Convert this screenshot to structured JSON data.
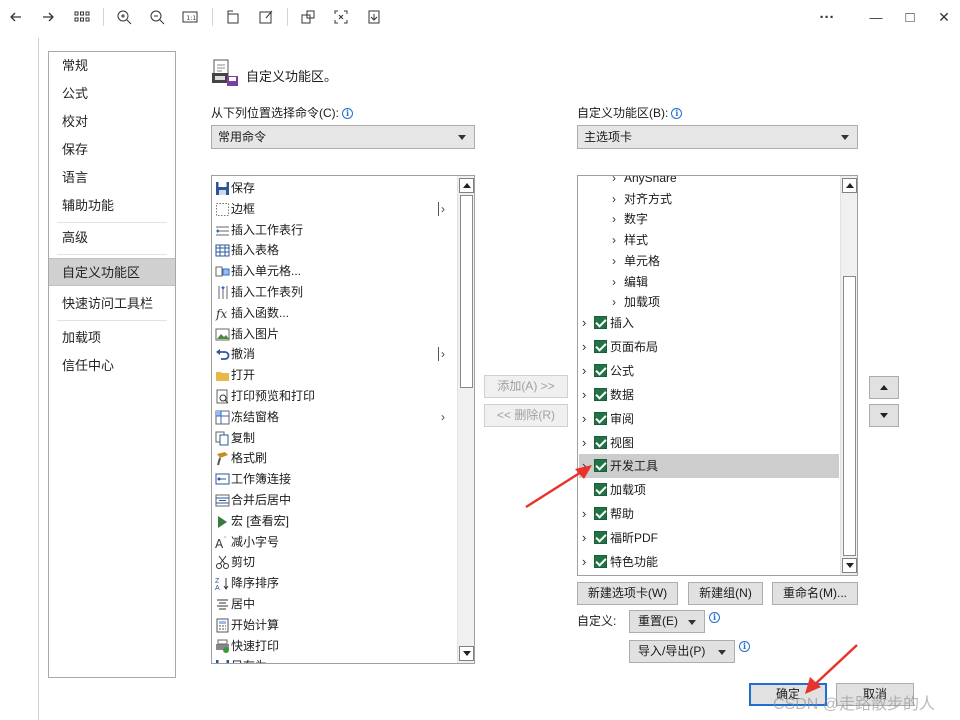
{
  "toolbar": {
    "items": [
      "back-icon",
      "forward-icon",
      "grid-icon",
      "zoom-in-icon",
      "zoom-out-icon",
      "actual-size-icon",
      "rotate-icon",
      "edit-icon",
      "crop-icon",
      "fit-icon",
      "download-icon"
    ],
    "more": "···",
    "minimize": "—",
    "maximize": "□",
    "close": "✕"
  },
  "sidebar": {
    "items": [
      {
        "label": "常规"
      },
      {
        "label": "公式"
      },
      {
        "label": "校对"
      },
      {
        "label": "保存"
      },
      {
        "label": "语言"
      },
      {
        "label": "辅助功能"
      },
      {
        "label": "高级"
      },
      {
        "label": "自定义功能区",
        "selected": true
      },
      {
        "label": "快速访问工具栏"
      },
      {
        "label": "加载项"
      },
      {
        "label": "信任中心"
      }
    ]
  },
  "main": {
    "heading": "自定义功能区。",
    "left_label": "从下列位置选择命令(C):",
    "left_combo": "常用命令",
    "right_label": "自定义功能区(B):",
    "right_combo": "主选项卡",
    "commands": [
      {
        "label": "保存",
        "icon": "save-icon"
      },
      {
        "label": "边框",
        "icon": "border-icon",
        "submenu": "bar"
      },
      {
        "label": "插入工作表行",
        "icon": "insert-row-icon"
      },
      {
        "label": "插入表格",
        "icon": "table-icon"
      },
      {
        "label": "插入单元格...",
        "icon": "insert-cells-icon"
      },
      {
        "label": "插入工作表列",
        "icon": "insert-column-icon"
      },
      {
        "label": "插入函数...",
        "icon": "function-icon"
      },
      {
        "label": "插入图片",
        "icon": "picture-icon"
      },
      {
        "label": "撤消",
        "icon": "undo-icon",
        "submenu": "bar"
      },
      {
        "label": "打开",
        "icon": "folder-icon"
      },
      {
        "label": "打印预览和打印",
        "icon": "print-preview-icon"
      },
      {
        "label": "冻结窗格",
        "icon": "freeze-panes-icon",
        "submenu": "arrow"
      },
      {
        "label": "复制",
        "icon": "copy-icon"
      },
      {
        "label": "格式刷",
        "icon": "format-painter-icon"
      },
      {
        "label": "工作簿连接",
        "icon": "connections-icon"
      },
      {
        "label": "合并后居中",
        "icon": "merge-center-icon"
      },
      {
        "label": "宏 [查看宏]",
        "icon": "macro-icon"
      },
      {
        "label": "减小字号",
        "icon": "decrease-font-icon"
      },
      {
        "label": "剪切",
        "icon": "cut-icon"
      },
      {
        "label": "降序排序",
        "icon": "sort-desc-icon"
      },
      {
        "label": "居中",
        "icon": "align-center-icon"
      },
      {
        "label": "开始计算",
        "icon": "calculator-icon"
      },
      {
        "label": "快速打印",
        "icon": "quick-print-icon"
      },
      {
        "label": "另存为",
        "icon": "save-as-icon"
      }
    ],
    "groups": [
      "AnyShare",
      "对齐方式",
      "数字",
      "样式",
      "单元格",
      "编辑",
      "加载项"
    ],
    "tabs": [
      {
        "label": "插入",
        "checked": true
      },
      {
        "label": "页面布局",
        "checked": true
      },
      {
        "label": "公式",
        "checked": true
      },
      {
        "label": "数据",
        "checked": true
      },
      {
        "label": "审阅",
        "checked": true
      },
      {
        "label": "视图",
        "checked": true
      },
      {
        "label": "开发工具",
        "checked": true,
        "selected": true
      },
      {
        "label": "加载项",
        "checked": true,
        "no_chevron": true
      },
      {
        "label": "帮助",
        "checked": true
      },
      {
        "label": "福昕PDF",
        "checked": true
      },
      {
        "label": "特色功能",
        "checked": true
      }
    ],
    "add_button": "添加(A) >>",
    "remove_button": "<< 删除(R)",
    "new_tab_button": "新建选项卡(W)",
    "new_group_button": "新建组(N)",
    "rename_button": "重命名(M)...",
    "customize_label": "自定义:",
    "reset_button": "重置(E)",
    "import_export_button": "导入/导出(P)",
    "ok_button": "确定",
    "cancel_button": "取消"
  },
  "watermark": "CSDN @走路散步的人",
  "colors": {
    "checkbox": "#217346",
    "selected_row": "#cdcdcd",
    "primary_border": "#1f6fd1",
    "annotation_arrow": "#e8322b"
  }
}
